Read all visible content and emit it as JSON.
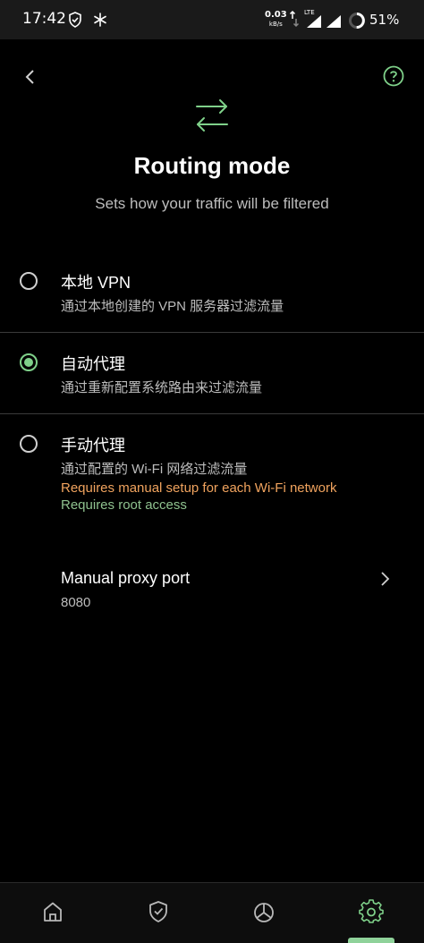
{
  "status_bar": {
    "time": "17:42",
    "net_speed": "0.03",
    "net_unit": "kB/s",
    "network_type": "LTE",
    "battery": "51%"
  },
  "header": {
    "title": "Routing mode",
    "subtitle": "Sets how your traffic will be filtered"
  },
  "options": [
    {
      "title": "本地 VPN",
      "description": "通过本地创建的 VPN 服务器过滤流量",
      "selected": false
    },
    {
      "title": "自动代理",
      "description": "通过重新配置系统路由来过滤流量",
      "selected": true
    },
    {
      "title": "手动代理",
      "description": "通过配置的 Wi-Fi 网络过滤流量",
      "warning": "Requires manual setup for each Wi-Fi network",
      "note": "Requires root access",
      "selected": false
    }
  ],
  "proxy_port": {
    "label": "Manual proxy port",
    "value": "8080"
  },
  "bottom_nav": {
    "items": [
      "home-icon",
      "shield-icon",
      "stats-icon",
      "settings-icon"
    ],
    "active": "settings-icon"
  },
  "colors": {
    "accent": "#7fd18a",
    "warning": "#f0a35e",
    "note": "#8fc28f",
    "background": "#000000"
  }
}
